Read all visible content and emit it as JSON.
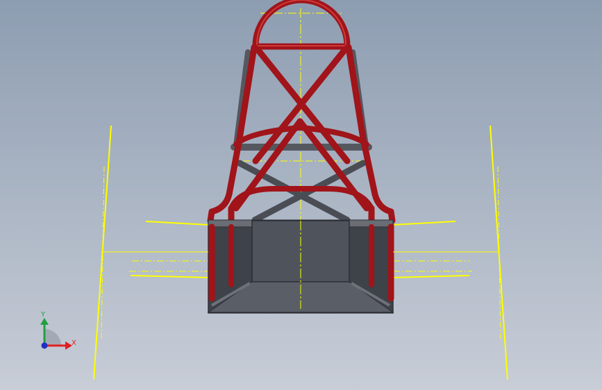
{
  "scene": {
    "background_top": "#8D9DB1",
    "background_bottom": "#C5CBD6",
    "tube_color": "#A0141A",
    "tube_highlight": "#D23A3A",
    "steel_color": "#5A5D64",
    "panel_color": "#4F545C",
    "sketch_color": "#FFFF00"
  },
  "triad": {
    "x_label": "X",
    "y_label": "Y",
    "x_color": "#E02020",
    "y_color": "#20A040",
    "z_color": "#2030C0",
    "x_icon": "x-axis-arrow-icon",
    "y_icon": "y-axis-arrow-icon",
    "z_icon": "z-axis-dot-icon"
  }
}
